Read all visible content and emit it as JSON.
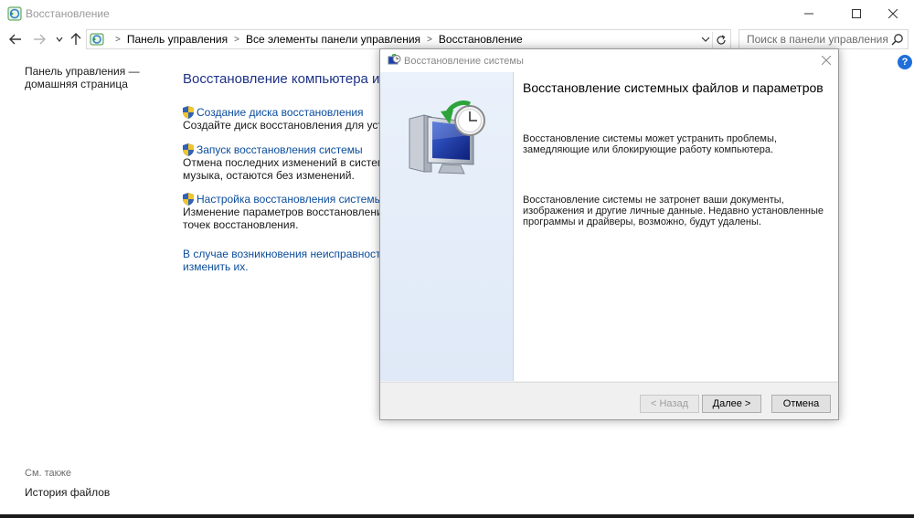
{
  "window": {
    "title": "Восстановление"
  },
  "address": {
    "crumbs": [
      "Панель управления",
      "Все элементы панели управления",
      "Восстановление"
    ]
  },
  "search": {
    "placeholder": "Поиск в панели управления"
  },
  "left": {
    "home_line1": "Панель управления —",
    "home_line2": "домашняя страница",
    "see_also": "См. также",
    "history": "История файлов"
  },
  "main": {
    "title": "Восстановление компьютера или",
    "items": [
      {
        "link": "Создание диска восстановления",
        "desc": [
          "Создайте диск восстановления для устранен"
        ]
      },
      {
        "link": "Запуск восстановления системы",
        "desc": [
          "Отмена последних изменений в системе; фа",
          "музыка, остаются без изменений."
        ]
      },
      {
        "link": "Настройка восстановления системы",
        "desc": [
          "Изменение параметров восстановления, упр",
          "точек восстановления."
        ]
      }
    ],
    "bottom_link": [
      "В случае возникновения неисправностей с к",
      "изменить их."
    ]
  },
  "dialog": {
    "title": "Восстановление системы",
    "heading": "Восстановление системных файлов и параметров",
    "p1": [
      "Восстановление системы может устранить проблемы,",
      "замедляющие или блокирующие работу компьютера."
    ],
    "p2": [
      "Восстановление системы не затронет ваши документы,",
      "изображения и другие личные данные. Недавно установленные",
      "программы и драйверы, возможно, будут удалены."
    ],
    "back": "< Назад",
    "next": "Далее >",
    "cancel": "Отмена"
  },
  "colors": {
    "link": "#0a4c9b",
    "title": "#1e3287",
    "help": "#1e6fd9"
  },
  "icons": [
    "recovery-icon",
    "back-icon",
    "forward-icon",
    "recent-icon",
    "up-icon",
    "control-panel-icon",
    "chevron-down-icon",
    "refresh-icon",
    "search-icon",
    "help-icon",
    "shield-icon",
    "close-icon",
    "system-restore-icon"
  ]
}
